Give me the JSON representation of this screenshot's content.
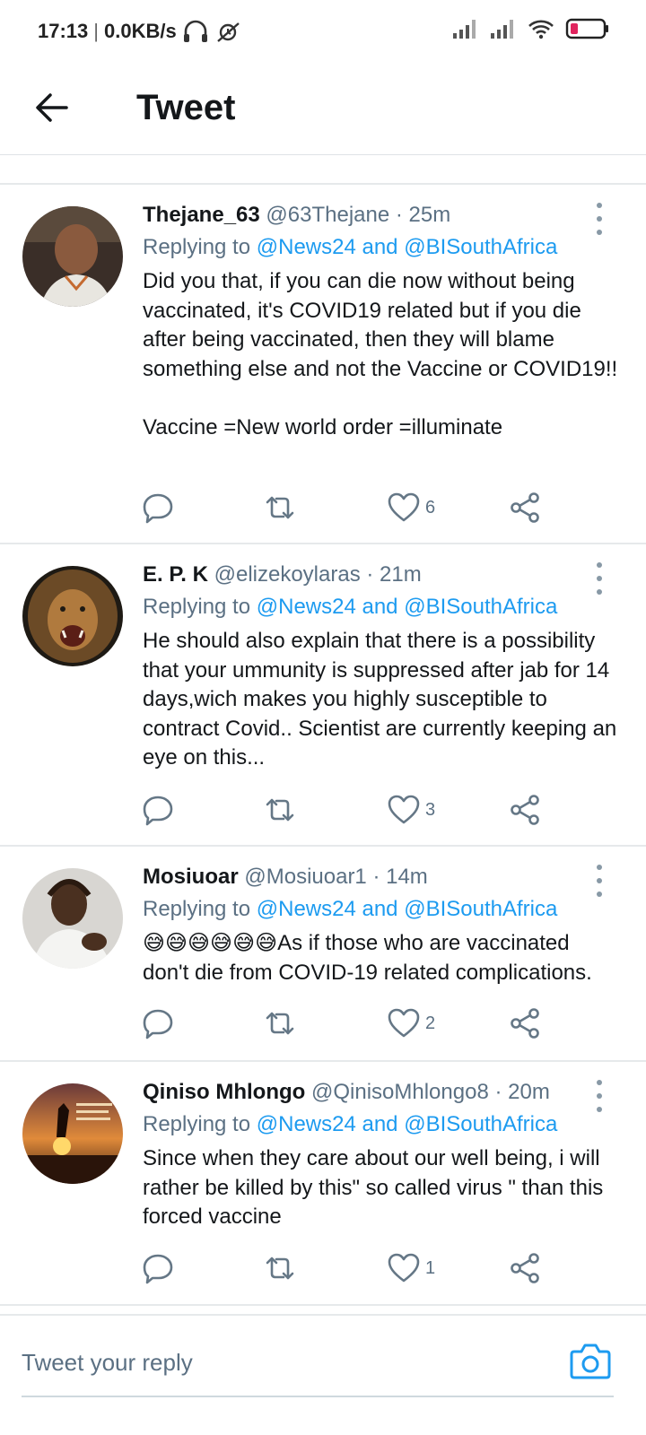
{
  "status_bar": {
    "time": "17:13",
    "separator": "|",
    "network_speed": "0.0KB/s",
    "icons": [
      "headphones-icon",
      "no-alarm-icon",
      "signal-icon",
      "signal-icon-2",
      "wifi-icon",
      "battery-low-icon"
    ]
  },
  "header": {
    "title": "Tweet",
    "back_icon": "arrow-left-icon"
  },
  "tweets": [
    {
      "name": "Thejane_63",
      "handle": "@63Thejane",
      "time": "· 25m",
      "replying_prefix": "Replying to ",
      "replying_to": "@News24 and @BISouthAfrica",
      "text": "Did you that, if you can die now without being vaccinated, it's COVID19 related but if you die after being vaccinated, then they will blame something else and not the Vaccine or COVID19!!\n\nVaccine =New world order =illuminate",
      "like_count": "6"
    },
    {
      "name": "E. P. K",
      "handle": "@elizekoylaras",
      "time": "· 21m",
      "replying_prefix": "Replying to ",
      "replying_to": "@News24 and @BISouthAfrica",
      "text": "He should also explain that there is a possibility that your ummunity is suppressed after jab for 14 days,wich makes you highly susceptible to contract Covid.. Scientist are currently keeping an eye on this...",
      "like_count": "3"
    },
    {
      "name": "Mosiuoar",
      "handle": "@Mosiuoar1",
      "time": "· 14m",
      "replying_prefix": "Replying to ",
      "replying_to": "@News24 and @BISouthAfrica",
      "text": "😅😅😅😅😅😅As if those who are vaccinated don't die from COVID-19 related complications.",
      "like_count": "2"
    },
    {
      "name": "Qiniso Mhlongo",
      "handle": "@QinisoMhlongo8",
      "time": "· 20m",
      "replying_prefix": "Replying to ",
      "replying_to": "@News24 and @BISouthAfrica",
      "text": "Since when they care about our well being, i will rather be killed by this\" so called virus \" than this forced vaccine",
      "like_count": "1"
    }
  ],
  "reply_bar": {
    "placeholder": "Tweet your reply",
    "camera_icon": "camera-icon"
  },
  "colors": {
    "accent": "#1d9bf0",
    "muted": "#5b7083",
    "icon": "#657786",
    "battery_low": "#e0245e"
  }
}
